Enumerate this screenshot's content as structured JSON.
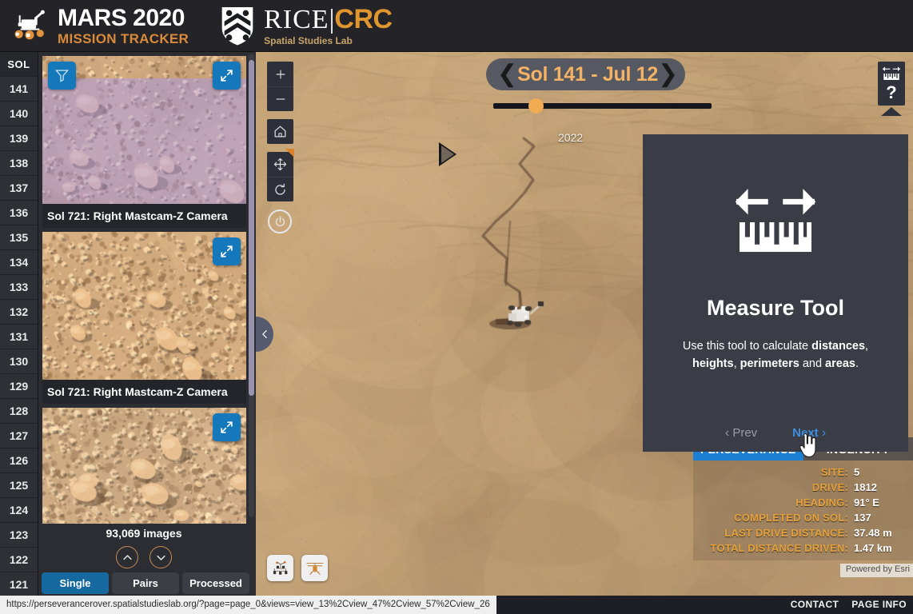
{
  "header": {
    "mission_title_line1": "MARS 2020",
    "mission_title_line2": "MISSION TRACKER",
    "rice_word": "RICE",
    "rice_bar": "|",
    "rice_crc": "CRC",
    "rice_sub": "Spatial Studies Lab",
    "rover_logo_icon": "rover-logo-icon",
    "shield_logo_icon": "rice-shield-icon"
  },
  "sol_column": {
    "header": "SOL",
    "items": [
      "141",
      "140",
      "139",
      "138",
      "137",
      "136",
      "135",
      "134",
      "133",
      "132",
      "131",
      "130",
      "129",
      "128",
      "127",
      "126",
      "125",
      "124",
      "123",
      "122",
      "121"
    ]
  },
  "image_panel": {
    "filter_icon": "filter-icon",
    "expand_icon": "expand-icon",
    "cards": [
      {
        "caption": "Sol 721: Right Mastcam-Z Camera",
        "has_filter": true,
        "tint": "purple"
      },
      {
        "caption": "Sol 721: Right Mastcam-Z Camera",
        "has_filter": false,
        "tint": "none"
      },
      {
        "caption": "",
        "has_filter": false,
        "tint": "none"
      }
    ],
    "image_count": "93,069 images",
    "scroll_up_icon": "chevron-up-icon",
    "scroll_down_icon": "chevron-down-icon",
    "tabs": [
      {
        "label": "Single",
        "active": true
      },
      {
        "label": "Pairs",
        "active": false
      },
      {
        "label": "Processed",
        "active": false
      }
    ],
    "collapse_icon": "chevron-left-icon"
  },
  "map": {
    "tools": [
      {
        "name": "zoom-in-button",
        "glyph": "+"
      },
      {
        "name": "zoom-out-button",
        "glyph": "−"
      },
      {
        "name": "home-button",
        "glyph": "home-icon"
      },
      {
        "name": "pan-button",
        "glyph": "pan-icon"
      },
      {
        "name": "rotate-button",
        "glyph": "rotate-icon"
      },
      {
        "name": "power-button",
        "glyph": "power-icon"
      }
    ],
    "topright": {
      "measure_icon": "measure-tool-icon",
      "help_label": "?"
    },
    "timeline": {
      "sol_label": "Sol 141 - Jul 12",
      "prev_icon": "chevron-left-icon",
      "next_icon": "chevron-right-icon",
      "play_icon": "play-icon",
      "year_tick": "2022"
    },
    "layer_icons": [
      {
        "name": "rover-layer-icon"
      },
      {
        "name": "helicopter-layer-icon"
      }
    ],
    "attribution": "Powered by Esri"
  },
  "dialog": {
    "icon": "measure-tool-icon",
    "title": "Measure Tool",
    "body_prefix": "Use this tool to calculate ",
    "body_b1": "distances",
    "body_mid1": ", ",
    "body_b2": "heights",
    "body_mid2": ", ",
    "body_b3": "perimeters",
    "body_mid3": " and ",
    "body_b4": "areas",
    "body_suffix": ".",
    "prev_label": "Prev",
    "next_label": "Next",
    "prev_chevron": "‹",
    "next_chevron": "›"
  },
  "rover_info": {
    "tabs": [
      {
        "label": "PERSEVERANCE",
        "active": true
      },
      {
        "label": "INGENUITY",
        "active": false
      }
    ],
    "rows": [
      {
        "label": "SITE:",
        "value": "5"
      },
      {
        "label": "DRIVE:",
        "value": "1812"
      },
      {
        "label": "HEADING:",
        "value": "91° E"
      },
      {
        "label": "COMPLETED ON SOL:",
        "value": "137"
      },
      {
        "label": "LAST DRIVE DISTANCE:",
        "value": "37.48 m"
      },
      {
        "label": "TOTAL DISTANCE DRIVEN:",
        "value": "1.47 km"
      }
    ]
  },
  "statusbar": {
    "url": "https://perseverancerover.spatialstudieslab.org/?page=page_0&views=view_13%2Cview_47%2Cview_57%2Cview_26",
    "links": [
      "CONTACT",
      "PAGE INFO"
    ]
  },
  "colors": {
    "accent_orange": "#d98a3a",
    "accent_blue": "#1578ba",
    "sol_text": "#f3b265",
    "panel_bg": "#2b2d33",
    "header_bg": "#242428"
  }
}
